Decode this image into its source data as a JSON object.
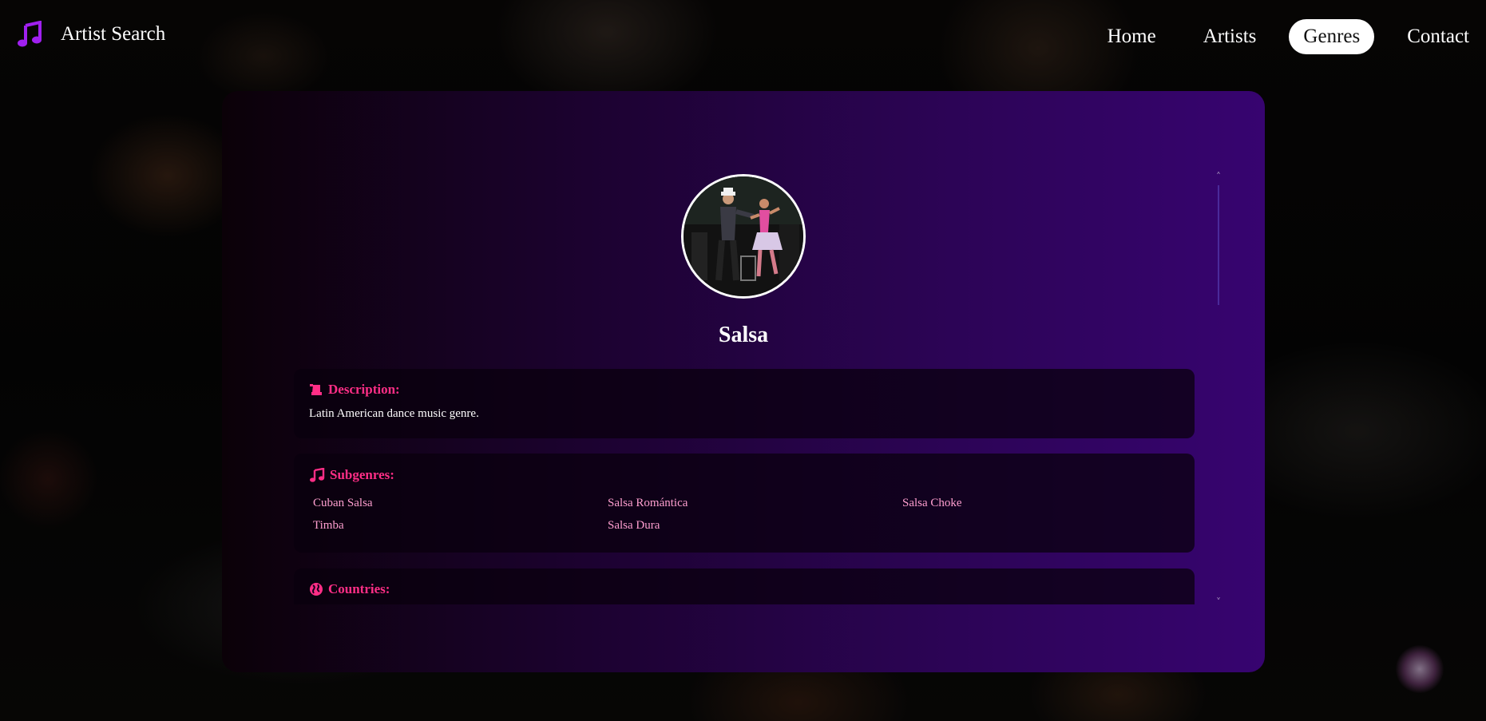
{
  "app": {
    "title": "Artist Search",
    "logo_icon": "music-note-icon"
  },
  "nav": {
    "items": [
      {
        "label": "Home",
        "active": false
      },
      {
        "label": "Artists",
        "active": false
      },
      {
        "label": "Genres",
        "active": true
      },
      {
        "label": "Contact",
        "active": false
      }
    ]
  },
  "genre": {
    "name": "Salsa",
    "image_icon": "dancers-photo",
    "description": {
      "heading": "Description:",
      "icon": "scroll-icon",
      "text": "Latin American dance music genre."
    },
    "subgenres": {
      "heading": "Subgenres:",
      "icon": "music-note-icon",
      "items": [
        "Cuban Salsa",
        "Salsa Romántica",
        "Salsa Choke",
        "Timba",
        "Salsa Dura"
      ]
    },
    "countries": {
      "heading": "Countries:",
      "icon": "globe-icon"
    }
  },
  "colors": {
    "accent": "#ff2e86",
    "link": "#ff9fd0",
    "card_start": "#0b0108",
    "card_end": "#370470"
  }
}
